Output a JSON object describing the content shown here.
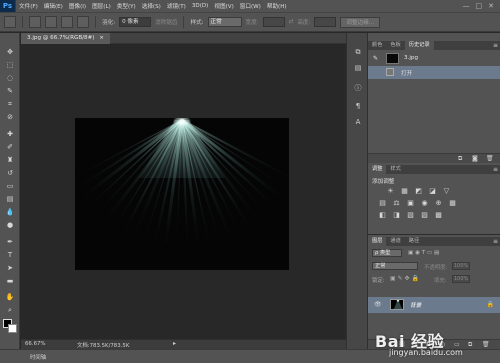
{
  "app": {
    "logo": "Ps"
  },
  "menu": [
    "文件(F)",
    "编辑(E)",
    "图像(I)",
    "图层(L)",
    "类型(Y)",
    "选择(S)",
    "滤镜(T)",
    "3D(D)",
    "视图(V)",
    "窗口(W)",
    "帮助(H)"
  ],
  "window_controls": {
    "minimize": "—",
    "maximize": "□",
    "close": "✕"
  },
  "options_bar": {
    "feather_label": "羽化:",
    "feather_value": "0 像素",
    "antialias_label": "消除锯齿",
    "style_label": "样式:",
    "style_value": "正常",
    "width_label": "宽度:",
    "height_label": "高度:",
    "refine_edge_button": "调整边缘..."
  },
  "document": {
    "tab_label": "3.jpg @ 66.7%(RGB/8#)",
    "close_glyph": "×"
  },
  "status": {
    "zoom": "66.67%",
    "doc_info": "文档:783.5K/783.5K",
    "arrow": "▸"
  },
  "timeline": {
    "label": "时间轴"
  },
  "panels": {
    "history": {
      "tabs": [
        "颜色",
        "色板",
        "历史记录"
      ],
      "active_tab": 2,
      "snapshot_name": "3.jpg",
      "items": [
        "打开"
      ]
    },
    "adjustments": {
      "tabs": [
        "调整",
        "样式"
      ],
      "active_tab": 0,
      "title": "添加调整",
      "row1": [
        "☀",
        "▦",
        "◩",
        "◪",
        "▽"
      ],
      "row2": [
        "▤",
        "⚖",
        "▣",
        "◉",
        "⊕",
        "▦"
      ],
      "row3": [
        "◧",
        "◨",
        "▧",
        "▨",
        "▩"
      ]
    },
    "layers": {
      "tabs": [
        "图层",
        "通道",
        "路径"
      ],
      "active_tab": 0,
      "kind_label": "ρ 类型",
      "blend_mode": "正常",
      "opacity_label": "不透明度:",
      "opacity_value": "100%",
      "lock_label": "锁定:",
      "fill_label": "填充:",
      "fill_value": "100%",
      "layer_name": "背景"
    }
  },
  "watermark": {
    "logo": "Bai 经验",
    "url": "jingyan.baidu.com"
  },
  "colors": {
    "ui_dark": "#535353",
    "canvas_bg": "#282828",
    "selection_blue": "#6b7a8c",
    "beam": "#bfeee6"
  }
}
